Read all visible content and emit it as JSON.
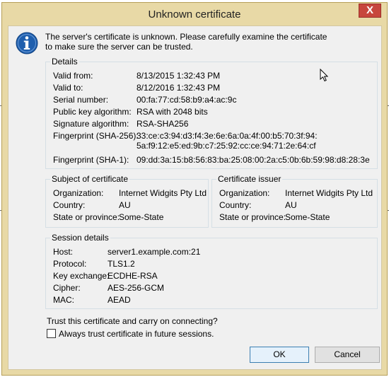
{
  "window": {
    "title": "Unknown certificate",
    "close_label": "X"
  },
  "intro": {
    "line1": "The server's certificate is unknown. Please carefully examine the certificate",
    "line2": "to make sure the server can be trusted."
  },
  "details": {
    "heading": "Details",
    "rows": [
      {
        "label": "Valid from:",
        "value": "8/13/2015 1:32:43 PM"
      },
      {
        "label": "Valid to:",
        "value": "8/12/2016 1:32:43 PM"
      },
      {
        "label": "Serial number:",
        "value": "00:fa:77:cd:58:b9:a4:ac:9c"
      },
      {
        "label": "Public key algorithm:",
        "value": "RSA with 2048 bits"
      },
      {
        "label": "Signature algorithm:",
        "value": "RSA-SHA256"
      },
      {
        "label": "Fingerprint (SHA-256):",
        "value": "33:ce:c3:94:d3:f4:3e:6e:6a:0a:4f:00:b5:70:3f:94:",
        "value2": "5a:f9:12:e5:ed:9b:c7:25:92:cc:ce:94:71:2e:64:cf"
      },
      {
        "label": "Fingerprint (SHA-1):",
        "value": "09:dd:3a:15:b8:56:83:ba:25:08:00:2a:c5:0b:6b:59:98:d8:28:3e"
      }
    ]
  },
  "subject": {
    "heading": "Subject of certificate",
    "rows": [
      {
        "label": "Organization:",
        "value": "Internet Widgits Pty Ltd"
      },
      {
        "label": "Country:",
        "value": "AU"
      },
      {
        "label": "State or province:",
        "value": "Some-State"
      }
    ]
  },
  "issuer": {
    "heading": "Certificate issuer",
    "rows": [
      {
        "label": "Organization:",
        "value": "Internet Widgits Pty Ltd"
      },
      {
        "label": "Country:",
        "value": "AU"
      },
      {
        "label": "State or province:",
        "value": "Some-State"
      }
    ]
  },
  "session": {
    "heading": "Session details",
    "rows": [
      {
        "label": "Host:",
        "value": "server1.example.com:21"
      },
      {
        "label": "Protocol:",
        "value": "TLS1.2"
      },
      {
        "label": "Key exchange:",
        "value": "ECDHE-RSA"
      },
      {
        "label": "Cipher:",
        "value": "AES-256-GCM"
      },
      {
        "label": "MAC:",
        "value": "AEAD"
      }
    ]
  },
  "trust": {
    "question": "Trust this certificate and carry on connecting?",
    "checkbox_label": "Always trust certificate in future sessions.",
    "checked": false
  },
  "buttons": {
    "ok": "OK",
    "cancel": "Cancel"
  },
  "colors": {
    "frame": "#e8d9a6",
    "close": "#c7463d",
    "client": "#f0f0f0",
    "info_icon": "#1f5fae"
  },
  "icons": {
    "info": "info-icon",
    "close": "close-icon",
    "cursor": "mouse-pointer-icon"
  }
}
